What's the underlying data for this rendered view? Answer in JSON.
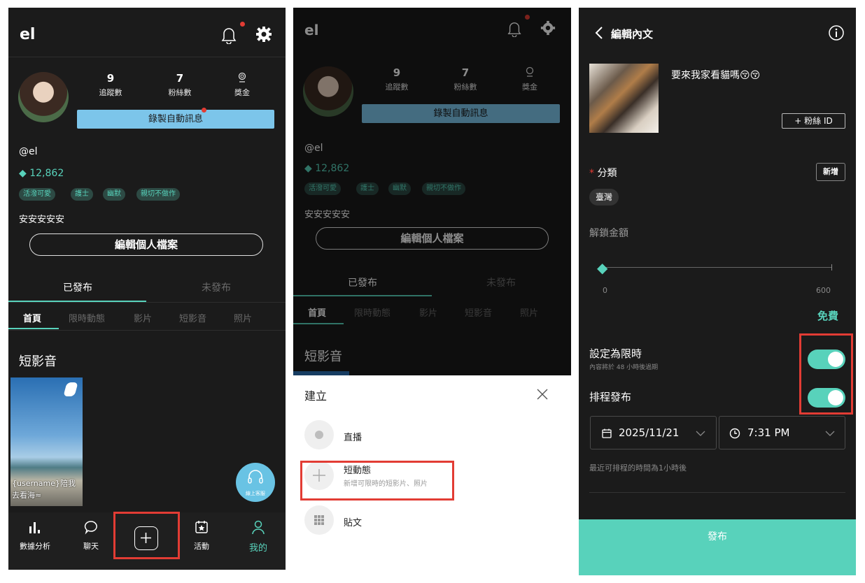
{
  "p1": {
    "brand": "el",
    "stats": [
      {
        "value": "9",
        "label": "追蹤數"
      },
      {
        "value": "7",
        "label": "粉絲數"
      },
      {
        "label": "獎金"
      }
    ],
    "record_btn": "錄製自動訊息",
    "handle": "@el",
    "diamonds": "12,862",
    "tags": [
      "活潑可愛",
      "護士",
      "幽默",
      "親切不做作"
    ],
    "bio": "安安安安安",
    "edit_profile": "編輯個人檔案",
    "tabs": [
      "已發布",
      "未發布"
    ],
    "subtabs": [
      "首頁",
      "限時動態",
      "影片",
      "短影音",
      "照片"
    ],
    "section_title": "短影音",
    "video_caption_1": "{username}陪我",
    "video_caption_2": "去看海",
    "support_label": "線上客服",
    "nav": [
      "數據分析",
      "聊天",
      "活動",
      "我的"
    ]
  },
  "p2": {
    "brand": "el",
    "stats": [
      {
        "value": "9",
        "label": "追蹤數"
      },
      {
        "value": "7",
        "label": "粉絲數"
      },
      {
        "label": "獎金"
      }
    ],
    "record_btn": "錄製自動訊息",
    "handle": "@el",
    "diamonds": "12,862",
    "tags": [
      "活潑可愛",
      "護士",
      "幽默",
      "親切不做作"
    ],
    "bio": "安安安安安",
    "edit_profile": "編輯個人檔案",
    "tabs": [
      "已發布",
      "未發布"
    ],
    "subtabs": [
      "首頁",
      "限時動態",
      "影片",
      "短影音",
      "照片"
    ],
    "section_title": "短影音",
    "sheet_title": "建立",
    "items": [
      {
        "label": "直播"
      },
      {
        "label": "短動態",
        "desc": "新增可限時的短影片、照片"
      },
      {
        "label": "貼文"
      }
    ]
  },
  "p3": {
    "title": "編輯內文",
    "post_text": "要來我家看貓嗎😚😚",
    "fan_id_btn": "+ 粉絲 ID",
    "category_label": "分類",
    "add_btn": "新增",
    "category_chip": "臺灣",
    "unlock_label": "解鎖金額",
    "slider_min": "0",
    "slider_max": "600",
    "slider_value": 0,
    "price_state": "免費",
    "limited_label": "設定為限時",
    "limited_desc": "內容將於 48 小時後過期",
    "schedule_label": "排程發布",
    "date": "2025/11/21",
    "time": "7:31 PM",
    "schedule_note": "最近可排程的時間為1小時後",
    "publish_btn": "發布",
    "limited_on": true,
    "schedule_on": true
  },
  "colors": {
    "accent": "#58d2bb",
    "record_btn": "#7cc5ea",
    "highlight": "#e23c34"
  }
}
